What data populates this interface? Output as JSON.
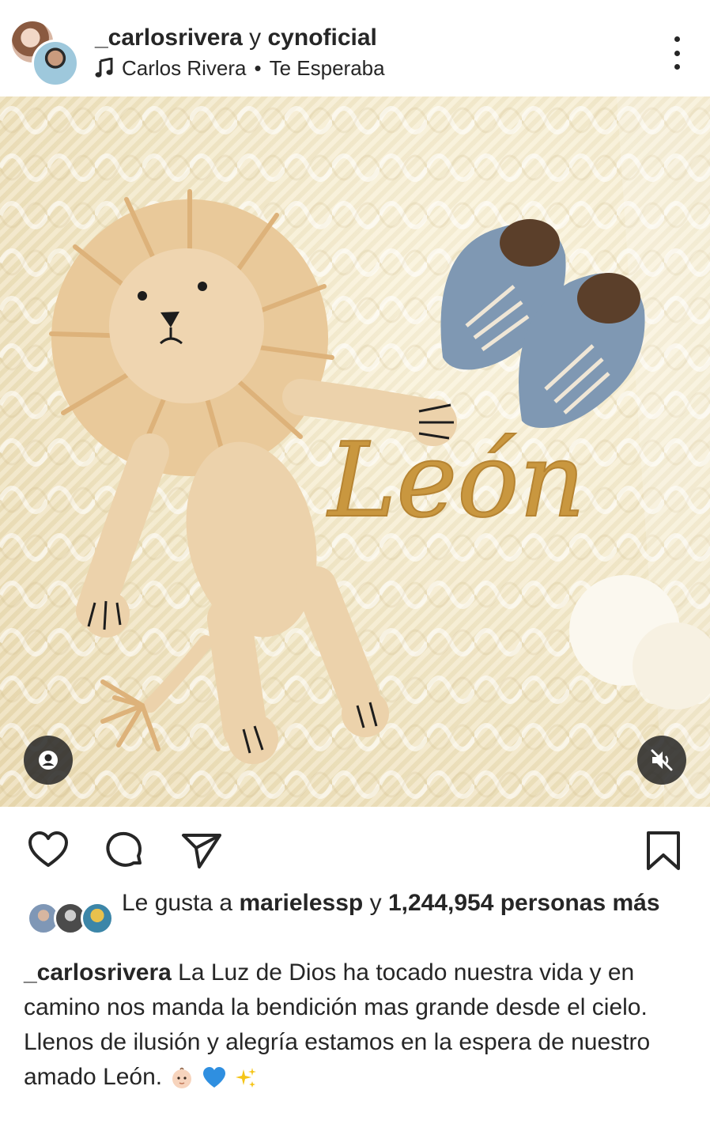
{
  "header": {
    "account_1": "_carlosrivera",
    "joiner": "y",
    "account_2": "cynoficial",
    "song_artist": "Carlos Rivera",
    "song_separator": "•",
    "song_title": "Te Esperaba",
    "icons": [
      "music-note-icon",
      "more-options-icon"
    ]
  },
  "media": {
    "embroidered_name": "León",
    "icons": [
      "user-tag-icon",
      "muted-speaker-icon"
    ]
  },
  "actions": {
    "icons": [
      "heart-icon",
      "comment-icon",
      "send-icon",
      "bookmark-icon"
    ]
  },
  "likes": {
    "prefix": "Le gusta a",
    "user": "marielessp",
    "joiner": "y",
    "count": "1,244,954 personas",
    "suffix": "más"
  },
  "caption": {
    "username": "_carlosrivera",
    "line_1": "La Luz de Dios ha tocado nuestra vida y en camino nos manda la bendición mas grande desde el cielo.",
    "line_2": "Llenos de ilusión y alegría estamos en la espera de nuestro amado León.",
    "emojis": [
      "baby-emoji",
      "blue-heart-emoji",
      "sparkles-emoji"
    ]
  },
  "colors": {
    "text": "#262626",
    "embroidery": "#c9973f",
    "shoe_blue": "#7f98b3",
    "blanket": "#f3e8c7"
  }
}
